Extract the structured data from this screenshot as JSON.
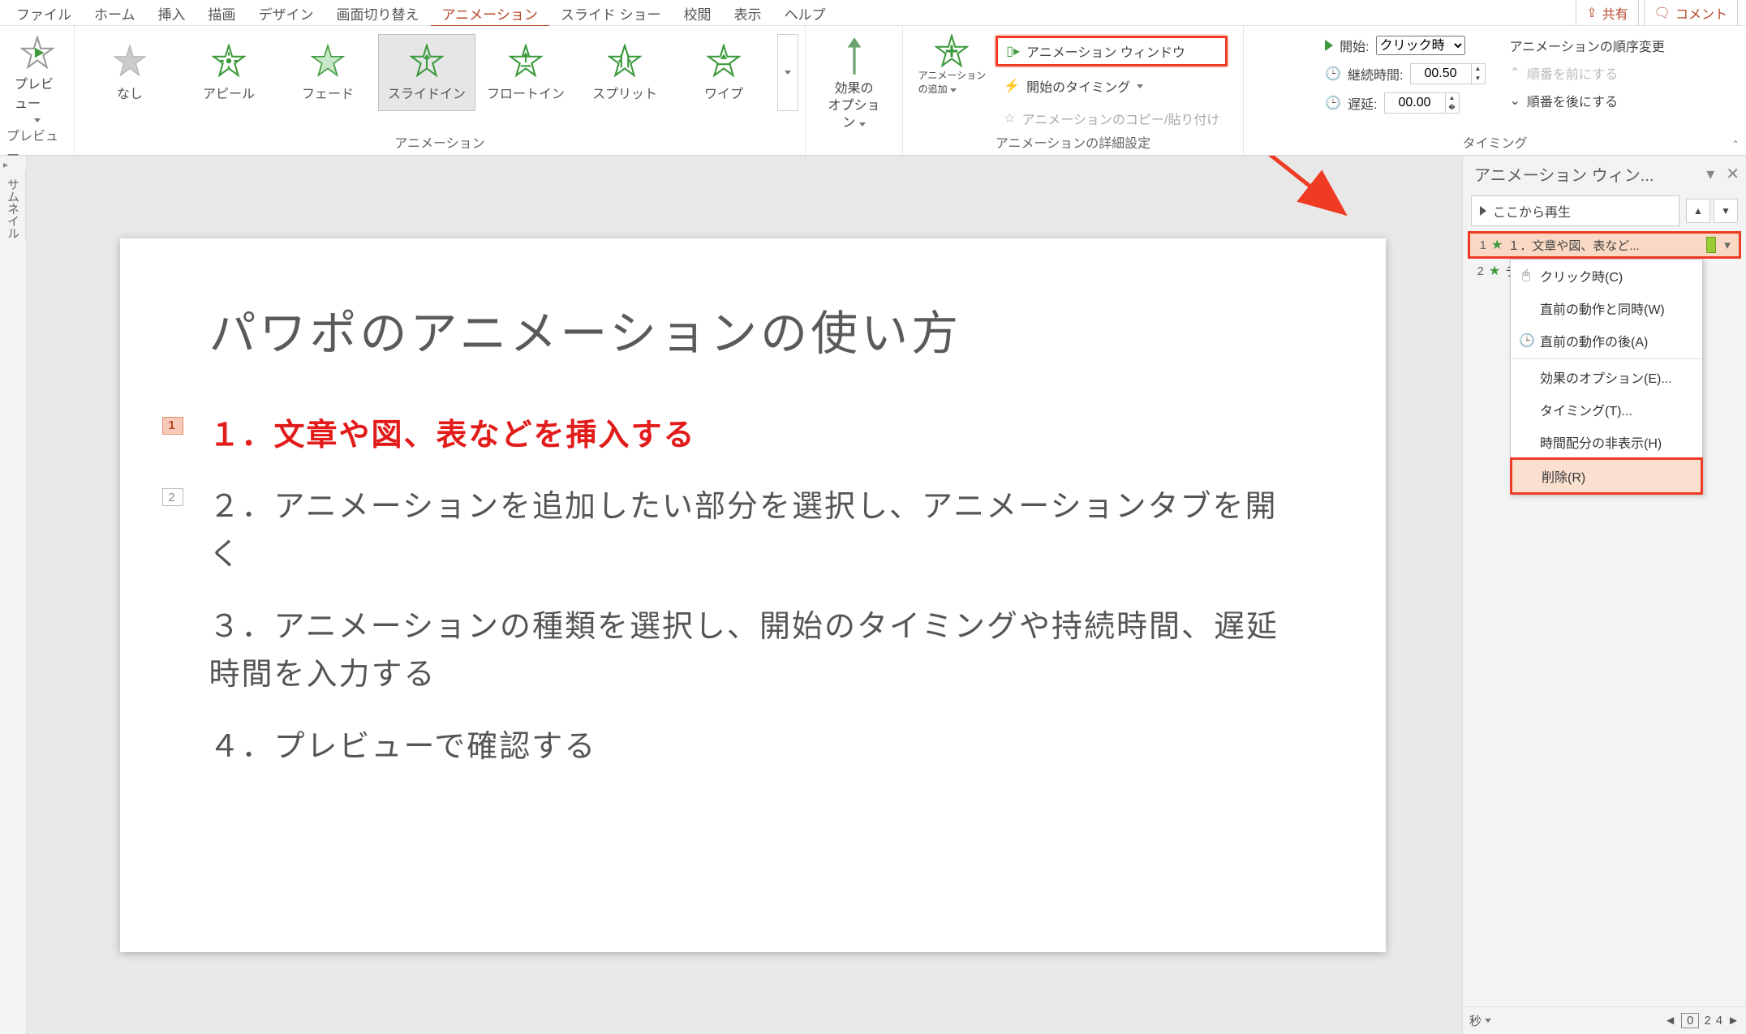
{
  "tabs": {
    "file": "ファイル",
    "home": "ホーム",
    "insert": "挿入",
    "draw": "描画",
    "design": "デザイン",
    "transition": "画面切り替え",
    "animation": "アニメーション",
    "slideshow": "スライド ショー",
    "review": "校閲",
    "view": "表示",
    "help": "ヘルプ"
  },
  "top_right": {
    "share": "共有",
    "comment": "コメント"
  },
  "ribbon": {
    "preview": {
      "label": "プレビュー",
      "group": "プレビュー"
    },
    "gallery": {
      "none": "なし",
      "appear": "アピール",
      "fade": "フェード",
      "slidein": "スライドイン",
      "floatin": "フロートイン",
      "split": "スプリット",
      "wipe": "ワイプ",
      "group": "アニメーション"
    },
    "options": {
      "label1": "効果の",
      "label2": "オプション"
    },
    "advanced": {
      "add1": "アニメーション",
      "add2": "の追加",
      "pane": "アニメーション ウィンドウ",
      "trigger": "開始のタイミング",
      "copy": "アニメーションのコピー/貼り付け",
      "group": "アニメーションの詳細設定"
    },
    "timing": {
      "start": "開始:",
      "start_val": "クリック時",
      "duration": "継続時間:",
      "duration_val": "00.50",
      "delay": "遅延:",
      "delay_val": "00.00",
      "reorder": "アニメーションの順序変更",
      "earlier": "順番を前にする",
      "later": "順番を後にする",
      "group": "タイミング"
    }
  },
  "slide": {
    "title": "パワポのアニメーションの使い方",
    "l1": "１．文章や図、表などを挿入する",
    "l2": "２．アニメーションを追加したい部分を選択し、アニメーションタブを開く",
    "l3": "３．アニメーションの種類を選択し、開始のタイミングや持続時間、遅延時間を入力する",
    "l4": "４．プレビューで確認する",
    "badge1": "1",
    "badge2": "2"
  },
  "thumb_rail": "サムネイル",
  "pane": {
    "title": "アニメーション ウィン...",
    "play": "ここから再生",
    "item1": {
      "ord": "1",
      "text": "１．文章や図、表など..."
    },
    "item2": {
      "ord": "2",
      "text": "テキスト"
    },
    "ctx": {
      "click": "クリック時(C)",
      "with": "直前の動作と同時(W)",
      "after": "直前の動作の後(A)",
      "effect": "効果のオプション(E)...",
      "timing": "タイミング(T)...",
      "hide": "時間配分の非表示(H)",
      "remove": "削除(R)"
    },
    "sec": "秒",
    "nav": {
      "cur": "0",
      "n2": "2",
      "n4": "4"
    }
  }
}
